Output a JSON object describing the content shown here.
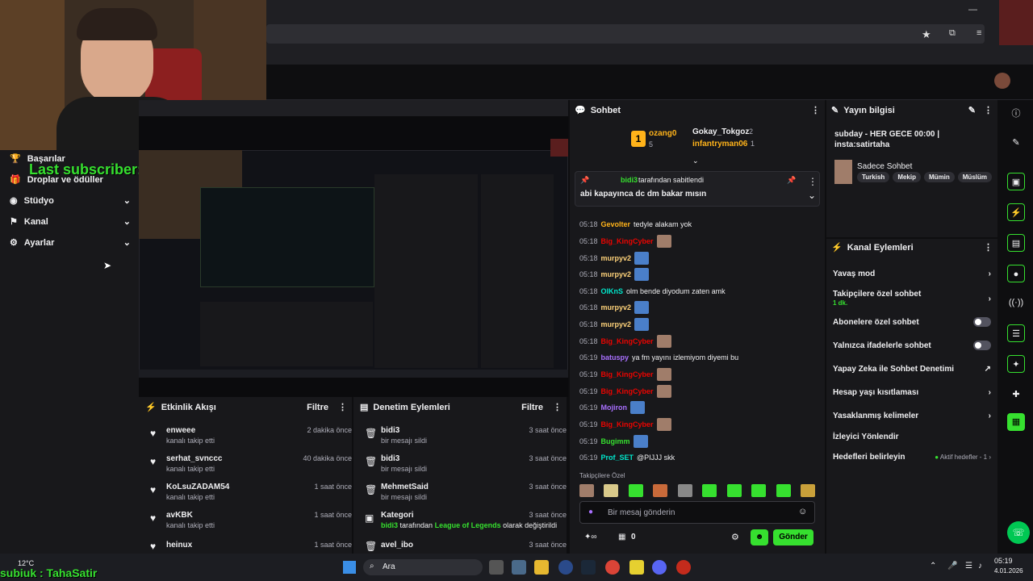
{
  "sidenav": {
    "items": [
      {
        "label": "Başarılar"
      },
      {
        "label": "Droplar ve ödüller"
      },
      {
        "label": "Stüdyo"
      },
      {
        "label": "Kanal"
      },
      {
        "label": "Ayarlar"
      }
    ]
  },
  "overlay": {
    "last_subscriber": "Last subscriber: Bolkenn",
    "stream_name": "subiuk : TahaSatir"
  },
  "activity": {
    "title": "Etkinlik Akışı",
    "filter": "Filtre",
    "items": [
      {
        "name": "enweee",
        "sub": "kanalı takip etti",
        "time": "2 dakika önce"
      },
      {
        "name": "serhat_svnccc",
        "sub": "kanalı takip etti",
        "time": "40 dakika önce"
      },
      {
        "name": "KoLsuZADAM54",
        "sub": "kanalı takip etti",
        "time": "1 saat önce"
      },
      {
        "name": "avKBK",
        "sub": "kanalı takip etti",
        "time": "1 saat önce"
      },
      {
        "name": "heinux",
        "sub": "",
        "time": "1 saat önce"
      }
    ]
  },
  "mod_actions": {
    "title": "Denetim Eylemleri",
    "filter": "Filtre",
    "items": [
      {
        "name": "bidi3",
        "sub": "bir mesajı sildi",
        "time": "3 saat önce"
      },
      {
        "name": "bidi3",
        "sub": "bir mesajı sildi",
        "time": "3 saat önce"
      },
      {
        "name": "MehmetSaid",
        "sub": "bir mesajı sildi",
        "time": "3 saat önce"
      },
      {
        "name": "Kategori",
        "sub": "tarafından",
        "time": "3 saat önce"
      },
      {
        "name": "avel_ibo",
        "sub": "",
        "time": "3 saat önce"
      }
    ],
    "category_user": "bidi3",
    "category_game": "League of Legends",
    "category_suffix": "olarak değiştirildi"
  },
  "chat": {
    "title": "Sohbet",
    "leaders": [
      {
        "name": "ozang0",
        "count": "5"
      },
      {
        "name": "Gokay_Tokgoz",
        "count": "2"
      },
      {
        "name": "infantryman06",
        "count": "1"
      }
    ],
    "rank": "1",
    "pinned": {
      "by": "bidi3",
      "by_suffix": "tarafından sabitlendi",
      "text": "abi kapayınca dc dm bakar mısın"
    },
    "messages": [
      {
        "time": "05:18",
        "user": "Gevolter",
        "color": "#ffb31a",
        "text": "tedyle alakam yok",
        "emote": ""
      },
      {
        "time": "05:18",
        "user": "Big_KingCyber",
        "color": "#eb0400",
        "text": "",
        "emote": "a"
      },
      {
        "time": "05:18",
        "user": "murpyv2",
        "color": "#ffd37a",
        "text": "",
        "emote": "b"
      },
      {
        "time": "05:18",
        "user": "murpyv2",
        "color": "#ffd37a",
        "text": "",
        "emote": "b"
      },
      {
        "time": "05:18",
        "user": "OlKnS",
        "color": "#00e6cb",
        "text": "olm bende diyodum zaten amk",
        "emote": ""
      },
      {
        "time": "05:18",
        "user": "murpyv2",
        "color": "#ffd37a",
        "text": "",
        "emote": "b"
      },
      {
        "time": "05:18",
        "user": "murpyv2",
        "color": "#ffd37a",
        "text": "",
        "emote": "b"
      },
      {
        "time": "05:18",
        "user": "Big_KingCyber",
        "color": "#eb0400",
        "text": "",
        "emote": "a"
      },
      {
        "time": "05:19",
        "user": "batuspy",
        "color": "#a970ff",
        "text": "ya fm yayını izlemiyom diyemi bu",
        "emote": ""
      },
      {
        "time": "05:19",
        "user": "Big_KingCyber",
        "color": "#eb0400",
        "text": "",
        "emote": "a"
      },
      {
        "time": "05:19",
        "user": "Big_KingCyber",
        "color": "#eb0400",
        "text": "",
        "emote": "a"
      },
      {
        "time": "05:19",
        "user": "Mojiron",
        "color": "#a970ff",
        "text": "",
        "emote": "b"
      },
      {
        "time": "05:19",
        "user": "Big_KingCyber",
        "color": "#eb0400",
        "text": "",
        "emote": "a"
      },
      {
        "time": "05:19",
        "user": "Bugimm",
        "color": "#36e02f",
        "text": "",
        "emote": "b"
      },
      {
        "time": "05:19",
        "user": "Prof_SET",
        "color": "#00e6cb",
        "text": "@PIJJJ skk",
        "emote": ""
      }
    ],
    "followers_only": "Takipçilere Özel",
    "input_placeholder": "Bir mesaj gönderin",
    "points": "0",
    "send": "Gönder"
  },
  "stream_info": {
    "title": "Yayın bilgisi",
    "stream_title": "subday - HER GECE 00:00 | insta:satirtaha",
    "category": "Sadece Sohbet",
    "tags": [
      "Turkish",
      "Mekip",
      "Mümin",
      "Müslüm"
    ]
  },
  "channel_actions": {
    "title": "Kanal Eylemleri",
    "items": [
      {
        "label": "Yavaş mod",
        "sub": "",
        "kind": "chevron"
      },
      {
        "label": "Takipçilere özel sohbet",
        "sub": "1 dk.",
        "kind": "chevron"
      },
      {
        "label": "Abonelere özel sohbet",
        "sub": "",
        "kind": "toggle"
      },
      {
        "label": "Yalnızca ifadelerle sohbet",
        "sub": "",
        "kind": "toggle"
      },
      {
        "label": "Yapay Zeka ile Sohbet Denetimi",
        "sub": "",
        "kind": "ext"
      },
      {
        "label": "Hesap yaşı kısıtlaması",
        "sub": "",
        "kind": "chevron"
      },
      {
        "label": "Yasaklanmış kelimeler",
        "sub": "",
        "kind": "chevron"
      },
      {
        "label": "İzleyici Yönlendir",
        "sub": "",
        "kind": "none"
      },
      {
        "label": "Hedefleri belirleyin",
        "sub": "Aktif hedefler - 1",
        "kind": "chevron"
      }
    ]
  },
  "taskbar": {
    "weather_temp": "12°C",
    "search": "Ara",
    "time": "05:19",
    "date": "4.01.2026"
  },
  "colors": {
    "accent": "#9147ff",
    "green": "#36e02f",
    "panel": "#18181b"
  }
}
